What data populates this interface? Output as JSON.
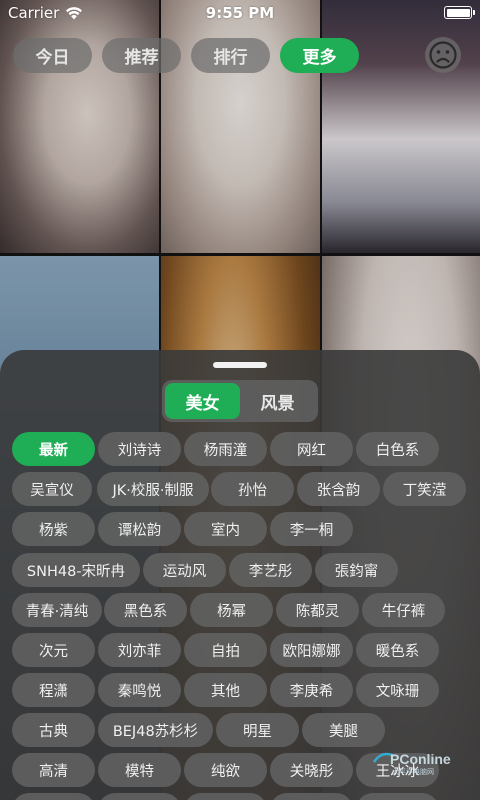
{
  "status_bar": {
    "carrier": "Carrier",
    "time": "9:55 PM"
  },
  "top_tabs": [
    {
      "label": "今日",
      "active": false
    },
    {
      "label": "推荐",
      "active": false
    },
    {
      "label": "排行",
      "active": false
    },
    {
      "label": "更多",
      "active": true
    }
  ],
  "profile_icon": "sad-face-icon",
  "sheet": {
    "segments": [
      {
        "label": "美女",
        "active": true
      },
      {
        "label": "风景",
        "active": false
      }
    ],
    "tags": [
      "最新",
      "刘诗诗",
      "杨雨潼",
      "网红",
      "白色系",
      "吴宣仪",
      "JK·校服·制服",
      "孙怡",
      "张含韵",
      "丁笑滢",
      "杨紫",
      "谭松韵",
      "室内",
      "李一桐",
      "SNH48-宋昕冉",
      "运动风",
      "李艺彤",
      "張鈞甯",
      "青春·清纯",
      "黑色系",
      "杨幂",
      "陈都灵",
      "牛仔裤",
      "次元",
      "刘亦菲",
      "自拍",
      "欧阳娜娜",
      "暖色系",
      "程潇",
      "秦鸣悦",
      "其他",
      "李庚希",
      "文咏珊",
      "古典",
      "BEJ48苏杉杉",
      "明星",
      "美腿",
      "高清",
      "模特",
      "纯欲",
      "关晓彤",
      "王冰冰"
    ],
    "active_tag": "最新"
  },
  "colors": {
    "accent": "#1fae55",
    "sheet_bg": "#3a3a3a",
    "chip_bg": "#5f5f5f"
  }
}
